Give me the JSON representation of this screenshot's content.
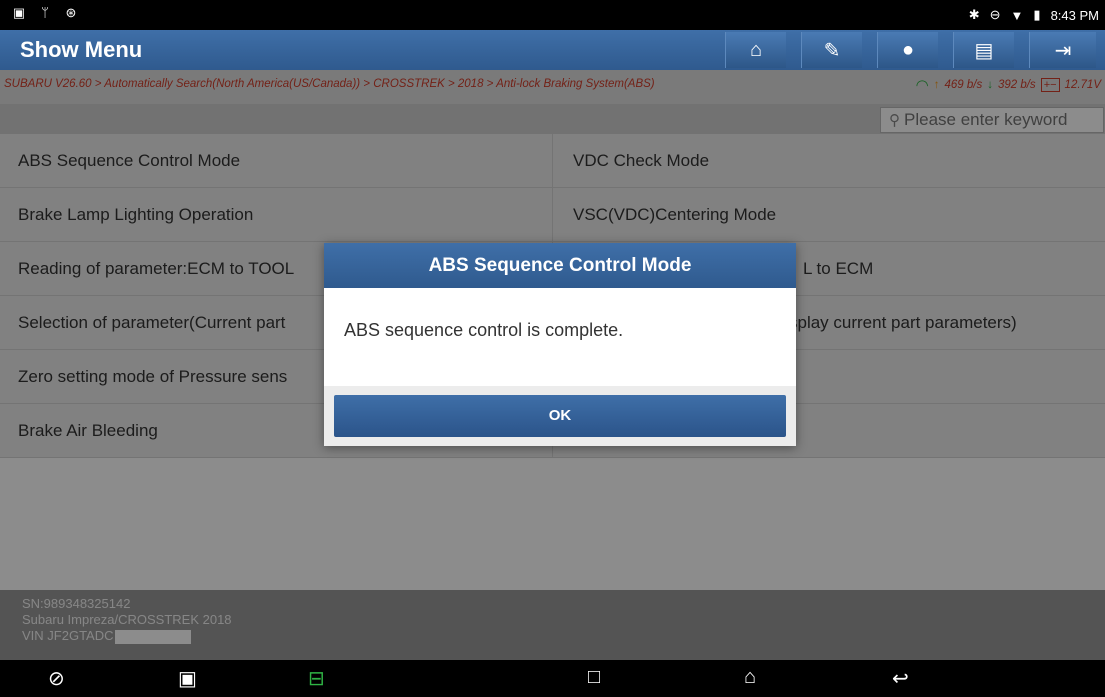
{
  "statusbar": {
    "left_icons": [
      "gallery-icon",
      "stethoscope-icon",
      "bluetooth-badge-icon"
    ],
    "right_icons": [
      "bluetooth-icon",
      "do-not-disturb-icon",
      "wifi-icon",
      "battery-icon"
    ],
    "time": "8:43 PM"
  },
  "header": {
    "title": "Show Menu",
    "buttons": [
      "home-icon",
      "edit-icon",
      "chat-icon",
      "print-icon",
      "exit-icon"
    ]
  },
  "breadcrumb": "SUBARU V26.60 > Automatically Search(North America(US/Canada)) > CROSSTREK > 2018 > Anti-lock Braking System(ABS)",
  "network": {
    "upload": "469 b/s",
    "download": "392 b/s",
    "voltage": "12.71V"
  },
  "search": {
    "placeholder": "Please enter keyword"
  },
  "menu": {
    "left": [
      "ABS Sequence Control Mode",
      "Brake Lamp Lighting Operation",
      "Reading of parameter:ECM to TOOL",
      "Selection of parameter(Current part",
      "Zero setting mode of Pressure sens",
      "Brake Air Bleeding"
    ],
    "right": [
      "VDC Check Mode",
      "VSC(VDC)Centering Mode",
      "L to ECM",
      "splay current part parameters)",
      "",
      ""
    ]
  },
  "footer": {
    "sn": "SN:989348325142",
    "vehicle": "Subaru Impreza/CROSSTREK 2018",
    "vin": "VIN JF2GTADC"
  },
  "dialog": {
    "title": "ABS Sequence Control Mode",
    "message": "ABS sequence control is complete.",
    "ok": "OK"
  },
  "navbar": {
    "icons": [
      "browser-icon",
      "gallery-icon",
      "vci-icon",
      "recents-icon",
      "home-icon",
      "back-icon"
    ]
  },
  "colors": {
    "header_blue": "#2f5a8e",
    "breadcrumb_red": "#d13d2a",
    "vci_green": "#2fb344"
  }
}
